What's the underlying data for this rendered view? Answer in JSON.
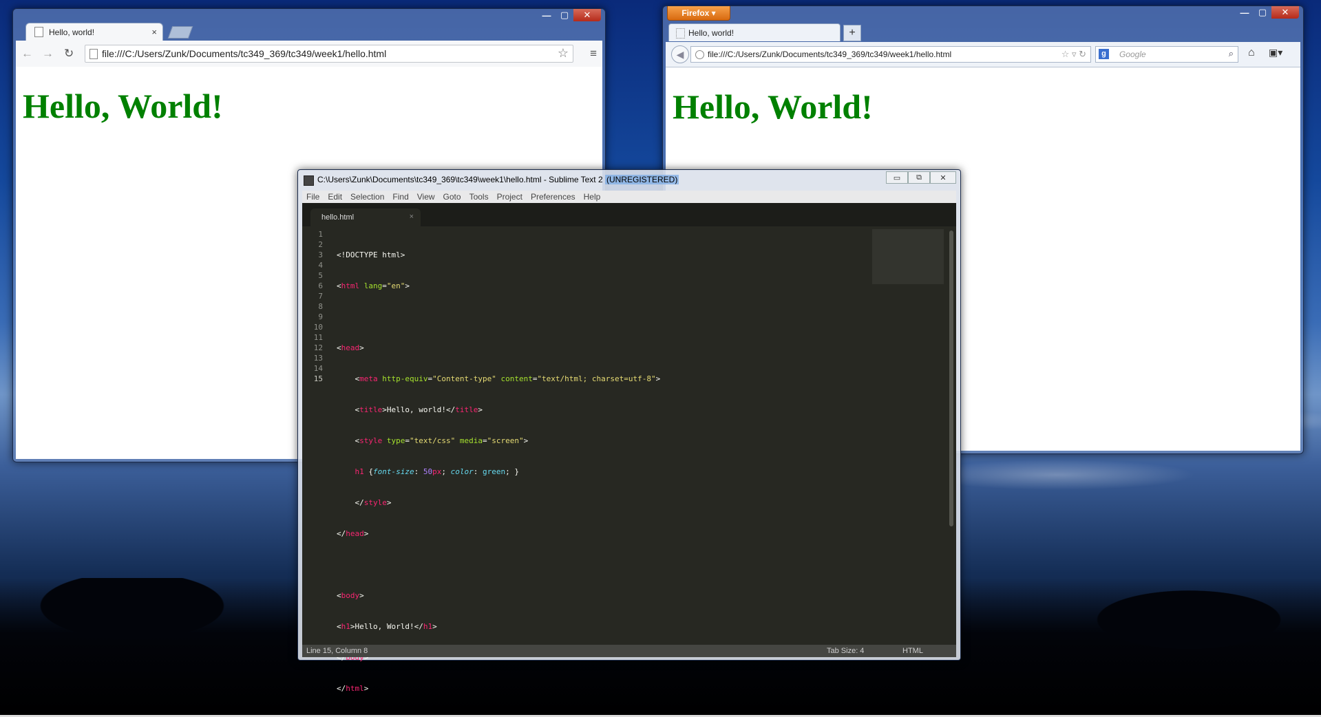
{
  "chrome": {
    "tab_title": "Hello, world!",
    "tab_close": "×",
    "url": "file:///C:/Users/Zunk/Documents/tc349_369/tc349/week1/hello.html",
    "page_heading": "Hello, World!",
    "back": "←",
    "forward": "→",
    "reload": "↻",
    "star": "☆",
    "menu": "≡"
  },
  "firefox": {
    "app_button": "Firefox ▾",
    "tab_title": "Hello, world!",
    "new_tab": "+",
    "url": "file:///C:/Users/Zunk/Documents/tc349_369/tc349/week1/hello.html",
    "search_placeholder": "Google",
    "page_heading": "Hello, World!"
  },
  "sublime": {
    "title_path": "C:\\Users\\Zunk\\Documents\\tc349_369\\tc349\\week1\\hello.html - Sublime Text 2 ",
    "title_reg": "(UNREGISTERED)",
    "menu": [
      "File",
      "Edit",
      "Selection",
      "Find",
      "View",
      "Goto",
      "Tools",
      "Project",
      "Preferences",
      "Help"
    ],
    "tab_name": "hello.html",
    "tab_close": "×",
    "line_numbers": [
      "1",
      "2",
      "3",
      "4",
      "5",
      "6",
      "7",
      "8",
      "9",
      "10",
      "11",
      "12",
      "13",
      "14",
      "15"
    ],
    "status_position": "Line 15, Column 8",
    "status_tabsize": "Tab Size: 4",
    "status_syntax": "HTML"
  },
  "window_controls": {
    "minimize": "—",
    "maximize": "▢",
    "close": "✕"
  }
}
